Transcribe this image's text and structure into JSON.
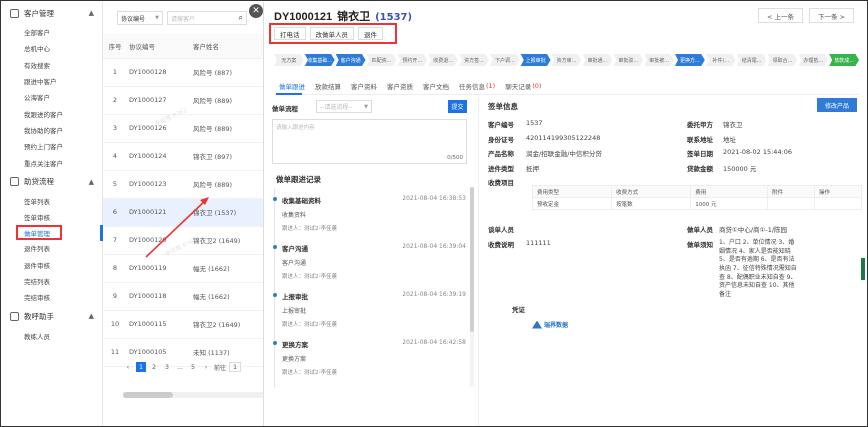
{
  "sidebar": {
    "groups": [
      {
        "label": "客户管理",
        "items": [
          "全部客户",
          "总机中心",
          "有效搜索",
          "跟进中客户",
          "公海客户",
          "我跟进的客户",
          "我协助的客户",
          "预约上门客户",
          "重点关注客户"
        ]
      },
      {
        "label": "助贷流程",
        "items": [
          "签单列表",
          "签单审核",
          "做单管理",
          "退件列表",
          "退件审核",
          "完结列表",
          "完结审核"
        ]
      },
      {
        "label": "教呼助手",
        "items": [
          "教练人员"
        ]
      }
    ],
    "active_item": "做单管理"
  },
  "list": {
    "filter_select": "协议编号",
    "search_placeholder": "请搜客户",
    "headers": [
      "序号",
      "协议编号",
      "客户姓名"
    ],
    "rows": [
      {
        "no": "1",
        "code": "DY1000128",
        "name": "风险号 (887)"
      },
      {
        "no": "2",
        "code": "DY1000127",
        "name": "风险号 (889)"
      },
      {
        "no": "3",
        "code": "DY1000126",
        "name": "风险号 (889)"
      },
      {
        "no": "4",
        "code": "DY1000124",
        "name": "锦衣卫 (897)"
      },
      {
        "no": "5",
        "code": "DY1000123",
        "name": "风险号 (889)"
      },
      {
        "no": "6",
        "code": "DY1000121",
        "name": "锦衣卫 (1537)"
      },
      {
        "no": "7",
        "code": "DY1000120",
        "name": "锦衣卫2 (1649)"
      },
      {
        "no": "8",
        "code": "DY1000119",
        "name": "幅无 (1662)"
      },
      {
        "no": "9",
        "code": "DY1000118",
        "name": "幅无 (1662)"
      },
      {
        "no": "10",
        "code": "DY1000115",
        "name": "锦衣卫2 (1649)"
      },
      {
        "no": "11",
        "code": "DY1000105",
        "name": "未知 (1137)"
      }
    ],
    "selected_index": 5,
    "pager": {
      "pages": [
        "1",
        "2",
        "3",
        "...",
        "5"
      ],
      "current": "1",
      "goto_label": "前往",
      "goto_value": "1"
    },
    "watermark": "李佳蕙 8762"
  },
  "detail": {
    "id": "DY1000121",
    "name": "锦衣卫",
    "number": "(1537)",
    "prev_label": "< 上一条",
    "next_label": "下一条 >",
    "actions": [
      "打电话",
      "改做单人员",
      "退件"
    ],
    "steps": [
      {
        "label": "无方案",
        "color": "gray"
      },
      {
        "label": "收集基础...",
        "color": "blue"
      },
      {
        "label": "客户沟通",
        "color": "blue"
      },
      {
        "label": "匹配资...",
        "color": "gray"
      },
      {
        "label": "预约开...",
        "color": "gray"
      },
      {
        "label": "收费退...",
        "color": "gray"
      },
      {
        "label": "资方签...",
        "color": "gray"
      },
      {
        "label": "下户调...",
        "color": "gray"
      },
      {
        "label": "上报审批",
        "color": "blue"
      },
      {
        "label": "资方审...",
        "color": "gray"
      },
      {
        "label": "审批通...",
        "color": "gray"
      },
      {
        "label": "审批驳...",
        "color": "gray"
      },
      {
        "label": "审批被...",
        "color": "gray"
      },
      {
        "label": "更换方...",
        "color": "blue"
      },
      {
        "label": "补件(...",
        "color": "gray"
      },
      {
        "label": "结清尾...",
        "color": "gray"
      },
      {
        "label": "领取合...",
        "color": "gray"
      },
      {
        "label": "办理抵...",
        "color": "gray"
      },
      {
        "label": "放款成...",
        "color": "green"
      }
    ],
    "tabs": [
      {
        "label": "做单跟进",
        "count": ""
      },
      {
        "label": "放款结算",
        "count": ""
      },
      {
        "label": "客户资料",
        "count": ""
      },
      {
        "label": "客户资质",
        "count": ""
      },
      {
        "label": "客户文档",
        "count": ""
      },
      {
        "label": "任务信息",
        "count": "(1)"
      },
      {
        "label": "聊天记录",
        "count": "(0)"
      }
    ],
    "flow_label": "做单流程",
    "flow_placeholder": "--请选流程--",
    "submit_label": "提交",
    "textarea_placeholder": "请输入跟进内容",
    "textarea_counter": "0/500",
    "records_title": "做单跟进记录",
    "records": [
      {
        "title": "收集基础资料",
        "time": "2021-08-04 16:38:53",
        "desc": "收集资料",
        "by": "跟进人：测试2-李佳蕙"
      },
      {
        "title": "客户沟通",
        "time": "2021-08-04 16:39:04",
        "desc": "客户沟通",
        "by": "跟进人：测试2-李佳蕙"
      },
      {
        "title": "上报审批",
        "time": "2021-08-04 16:39:19",
        "desc": "上报审批",
        "by": "跟进人：测试2-李佳蕙"
      },
      {
        "title": "更换方案",
        "time": "2021-08-04 16:42:58",
        "desc": "更换方案",
        "by": "跟进人：测试2-李佳蕙"
      }
    ],
    "info_title": "签单信息",
    "edit_product_label": "修改产品",
    "info_left": [
      {
        "k": "客户编号",
        "v": "1537"
      },
      {
        "k": "身份证号",
        "v": "420114199305122248"
      },
      {
        "k": "产品名称",
        "v": "润金/招联金融/中信积分贷"
      },
      {
        "k": "进件类型",
        "v": "抵押"
      },
      {
        "k": "收费项目",
        "v": ""
      }
    ],
    "info_right": [
      {
        "k": "委托甲方",
        "v": "锦衣卫"
      },
      {
        "k": "联系地址",
        "v": "地址"
      },
      {
        "k": "签单日期",
        "v": "2021-08-02 15:44:06"
      },
      {
        "k": "贷款金额",
        "v": "150000 元"
      }
    ],
    "fee_headers": [
      "费用类型",
      "收费方式",
      "费用",
      "附件",
      "操作"
    ],
    "fee_rows": [
      [
        "预收定金",
        "按笔数",
        "1000 元",
        "",
        ""
      ]
    ],
    "signer_label": "谈单人员",
    "signer_value": "",
    "charge_label": "收费说明",
    "charge_value": "111111",
    "maker_label": "做单人员",
    "maker_value": "商贷①中心/商①-1/陈园",
    "notice_label": "做单须知",
    "notice_value": "1、户口 2、单位情况 3、婚姻情况 4、家人是否能知晓 5、是否有逾期 6、是否有法执函 7、征信特殊情况需知自查 8、配偶职业未知自查 9、资产信息未知自查 10、其他备注",
    "credential_label": "凭证",
    "bank_name": "瑞界数据"
  }
}
